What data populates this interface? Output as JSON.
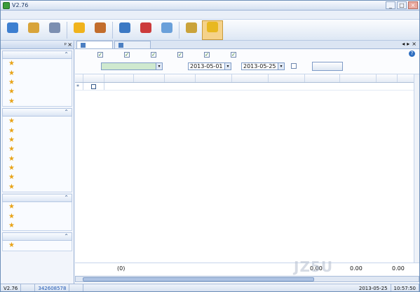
{
  "window": {
    "title": "V2.76",
    "min_glyph": "_",
    "max_glyph": "□",
    "close_glyph": "×"
  },
  "menu": [
    {
      "label": ""
    },
    {
      "label": ""
    },
    {
      "label": ""
    },
    {
      "label": ""
    },
    {
      "label": ""
    },
    {
      "label": ""
    },
    {
      "label": ""
    },
    {
      "label": ""
    }
  ],
  "toolbar": {
    "buttons": [
      {
        "label": "",
        "icon": "globe-icon",
        "color": "#3d7fd0"
      },
      {
        "label": "",
        "icon": "coins-icon",
        "color": "#d8a43a"
      },
      {
        "label": "",
        "icon": "document-icon",
        "color": "#7c8fb1"
      },
      {
        "label": "",
        "icon": "star-icon",
        "color": "#f0b31c"
      },
      {
        "label": "",
        "icon": "calculator-icon",
        "color": "#c26d2c"
      },
      {
        "label": "",
        "icon": "refresh-icon",
        "color": "#3c79c4"
      },
      {
        "label": "",
        "icon": "help-icon",
        "color": "#cc3b3b"
      },
      {
        "label": "",
        "icon": "upgrade-icon",
        "color": "#6aa0da"
      },
      {
        "label": "",
        "icon": "lock-icon",
        "color": "#caa33a"
      },
      {
        "label": "",
        "icon": "exit-icon",
        "color": "#e8b820"
      }
    ]
  },
  "sidebar": {
    "header": "",
    "pin_glyph": "ᵖ",
    "close_glyph": "×",
    "chevron_glyph": "⌃",
    "star_glyph": "★",
    "sections": [
      {
        "title": "",
        "items": [
          {
            "label": ""
          },
          {
            "label": ""
          },
          {
            "label": ""
          },
          {
            "label": ""
          },
          {
            "label": ""
          }
        ]
      },
      {
        "title": "",
        "items": [
          {
            "label": ""
          },
          {
            "label": ""
          },
          {
            "label": ""
          },
          {
            "label": ""
          },
          {
            "label": ""
          },
          {
            "label": ""
          },
          {
            "label": ""
          },
          {
            "label": ""
          }
        ]
      },
      {
        "title": "",
        "items": [
          {
            "label": ""
          },
          {
            "label": ""
          },
          {
            "label": ""
          }
        ]
      },
      {
        "title": "",
        "items": [
          {
            "label": ""
          }
        ]
      }
    ]
  },
  "tabs": [
    {
      "label": "",
      "active": true
    },
    {
      "label": "",
      "active": false
    }
  ],
  "tab_nav": {
    "prev": "◂",
    "next": "▸",
    "close": "×"
  },
  "filter": {
    "label_type": "",
    "checkboxes": [
      {
        "label": "",
        "checked": true
      },
      {
        "label": "",
        "checked": true
      },
      {
        "label": "",
        "checked": true
      },
      {
        "label": "",
        "checked": true
      },
      {
        "label": "",
        "checked": true
      },
      {
        "label": "",
        "checked": true
      }
    ],
    "check_glyph": "✓",
    "account_label": "",
    "account_value": "",
    "date_label": "",
    "date_from": "2013-05-01",
    "date_to": "2013-05-25",
    "to_label": "",
    "all_label": "",
    "query_button": "",
    "dropdown_glyph": "▾",
    "help_glyph": "?"
  },
  "table": {
    "headers": [
      "",
      "",
      "",
      "",
      "",
      "",
      "",
      "",
      "",
      "",
      "",
      ""
    ],
    "row_marker": "*"
  },
  "footer": {
    "total_label": "(0)",
    "income": "0.00",
    "expense": "0.00",
    "sum": "0.00"
  },
  "status": {
    "left": "V2.76",
    "middle": "",
    "qq": "342608578",
    "link": "",
    "date": "2013-05-25",
    "time": "10:57:50"
  },
  "watermark": "JZ5U"
}
